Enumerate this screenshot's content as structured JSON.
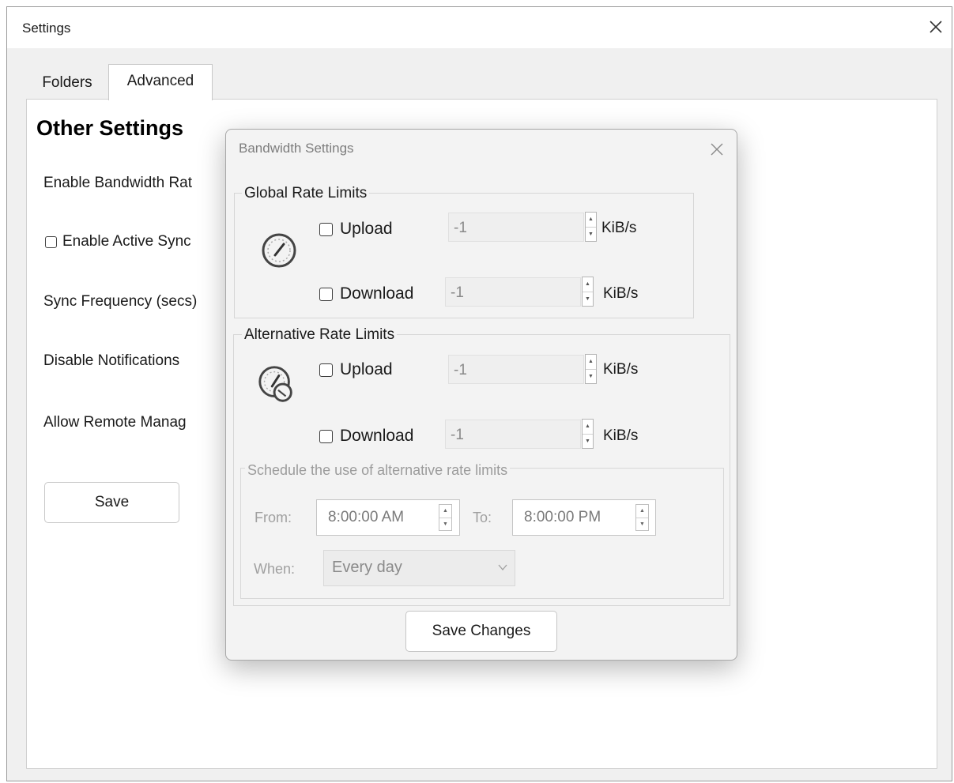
{
  "window": {
    "title": "Settings",
    "tabs": [
      {
        "label": "Folders"
      },
      {
        "label": "Advanced",
        "selected": true
      }
    ],
    "section_title": "Other Settings",
    "settings": {
      "bandwidth": "Enable Bandwidth Rat",
      "active_sync": "Enable Active Sync",
      "sync_frequency": "Sync Frequency (secs)",
      "notifications": "Disable Notifications",
      "remote": "Allow Remote Manag"
    },
    "save_label": "Save"
  },
  "dialog": {
    "title": "Bandwidth Settings",
    "global": {
      "legend": "Global Rate Limits",
      "upload_label": "Upload",
      "upload_value": "-1",
      "download_label": "Download",
      "download_value": "-1",
      "unit": "KiB/s"
    },
    "alternative": {
      "legend": "Alternative Rate Limits",
      "upload_label": "Upload",
      "upload_value": "-1",
      "download_label": "Download",
      "download_value": "-1",
      "unit": "KiB/s"
    },
    "schedule": {
      "legend": "Schedule the use of alternative rate limits",
      "from_label": "From:",
      "from_value": "8:00:00 AM",
      "to_label": "To:",
      "to_value": "8:00:00 PM",
      "when_label": "When:",
      "when_value": "Every day"
    },
    "save_changes_label": "Save Changes"
  },
  "icons": {
    "close": "close-icon",
    "gauge": "speedometer-icon",
    "alt_gauge": "speedometer-alt-icon",
    "chevron": "chevron-down-icon"
  },
  "colors": {
    "window_bg": "#f0f0f0",
    "dialog_bg": "#f3f3f3",
    "disabled_text": "#a0a0a0"
  }
}
